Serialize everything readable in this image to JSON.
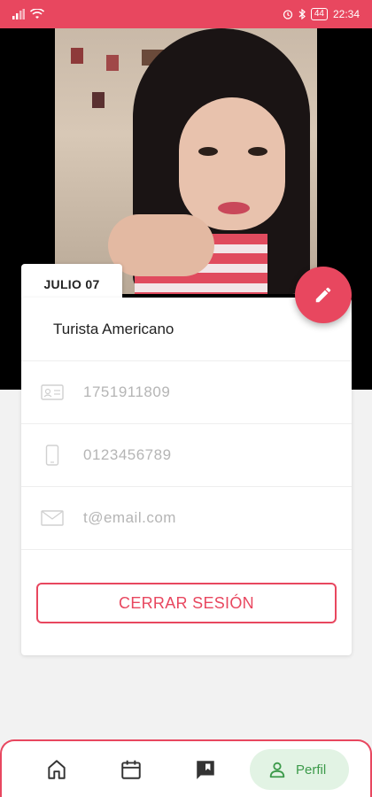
{
  "status_bar": {
    "time": "22:34",
    "battery": "44",
    "icons": [
      "signal-icon",
      "wifi-icon",
      "alarm-icon",
      "bluetooth-icon",
      "battery-icon"
    ]
  },
  "profile": {
    "date_badge": "JULIO 07",
    "name": "Turista Americano",
    "id_number": "1751911809",
    "phone": "0123456789",
    "email": "t@email.com"
  },
  "actions": {
    "logout_label": "CERRAR SESIÓN",
    "edit_icon": "pencil-icon"
  },
  "bottom_nav": {
    "items": [
      {
        "icon": "home-icon"
      },
      {
        "icon": "calendar-icon"
      },
      {
        "icon": "bookmark-icon"
      }
    ],
    "active": {
      "icon": "person-icon",
      "label": "Perfil"
    }
  },
  "colors": {
    "accent": "#e8475f",
    "active_nav_bg": "#e2f3e4",
    "active_nav_fg": "#3c9a4a"
  }
}
